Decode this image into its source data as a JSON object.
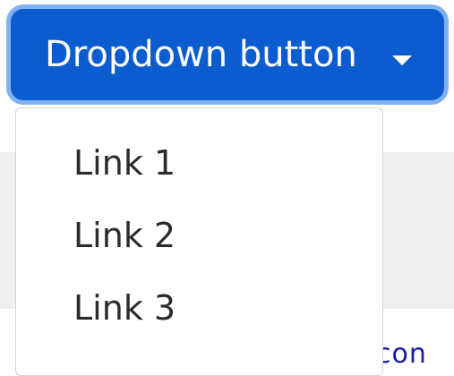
{
  "dropdown": {
    "button_label": "Dropdown button",
    "caret_icon": "caret-down-icon",
    "items": [
      {
        "label": "Link 1"
      },
      {
        "label": "Link 2"
      },
      {
        "label": "Link 3"
      }
    ]
  },
  "background": {
    "partial_text": "con"
  },
  "colors": {
    "button_bg": "#0a5ccf",
    "button_focus_ring": "#7fb2f3",
    "button_text": "#ffffff",
    "menu_bg": "#ffffff",
    "menu_border": "#d4d4d4",
    "item_text": "#2b2b2b",
    "page_band": "#efefef",
    "link_text": "#1a1aa6"
  }
}
